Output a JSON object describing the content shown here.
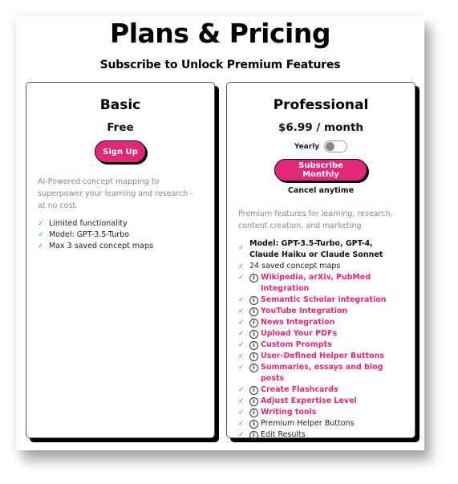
{
  "header": {
    "title": "Plans & Pricing",
    "subtitle": "Subscribe to Unlock Premium Features"
  },
  "colors": {
    "accent": "#e0287a",
    "check": "#3aa83a"
  },
  "plans": {
    "basic": {
      "name": "Basic",
      "price": "Free",
      "button_label": "Sign Up",
      "description": "AI-Powered concept mapping to superpower your learning and research - at no cost.",
      "features": [
        {
          "text": "Limited functionality",
          "icon": "check-icon"
        },
        {
          "text": "Model: GPT-3.5-Turbo",
          "icon": "check-icon"
        },
        {
          "text": "Max 3 saved concept maps",
          "icon": "check-icon"
        }
      ]
    },
    "professional": {
      "name": "Professional",
      "price": "$6.99 / month",
      "toggle_label": "Yearly",
      "toggle_on": false,
      "button_label": "Subscribe Monthly",
      "cancel_note": "Cancel anytime",
      "description": "Premium features for learning, research, content creation, and marketing",
      "features": [
        {
          "text": "Model: GPT-3.5-Turbo, GPT-4, Claude Haiku or Claude Sonnet",
          "style": "bold",
          "info": false
        },
        {
          "text": "24 saved concept maps",
          "style": "plain",
          "info": false
        },
        {
          "text": "Wikipedia, arXiv, PubMed Integration",
          "style": "link",
          "info": true
        },
        {
          "text": "Semantic Scholar integration",
          "style": "link",
          "info": true
        },
        {
          "text": "YouTube Integration",
          "style": "link",
          "info": true
        },
        {
          "text": "News Integration",
          "style": "link",
          "info": true
        },
        {
          "text": "Upload Your PDFs",
          "style": "link",
          "info": true
        },
        {
          "text": "Custom Prompts",
          "style": "link",
          "info": true
        },
        {
          "text": "User-Defined Helper Buttons",
          "style": "link",
          "info": true
        },
        {
          "text": "Summaries, essays and blog posts",
          "style": "link",
          "info": true
        },
        {
          "text": "Create Flashcards",
          "style": "link",
          "info": true
        },
        {
          "text": "Adjust Expertise Level",
          "style": "link",
          "info": true
        },
        {
          "text": "Writing tools",
          "style": "link",
          "info": true
        },
        {
          "text": "Premium Helper Buttons",
          "style": "plain",
          "info": true
        },
        {
          "text": "Edit Results",
          "style": "plain",
          "info": true
        }
      ]
    }
  },
  "icons": {
    "check": "✓",
    "info": "i"
  }
}
